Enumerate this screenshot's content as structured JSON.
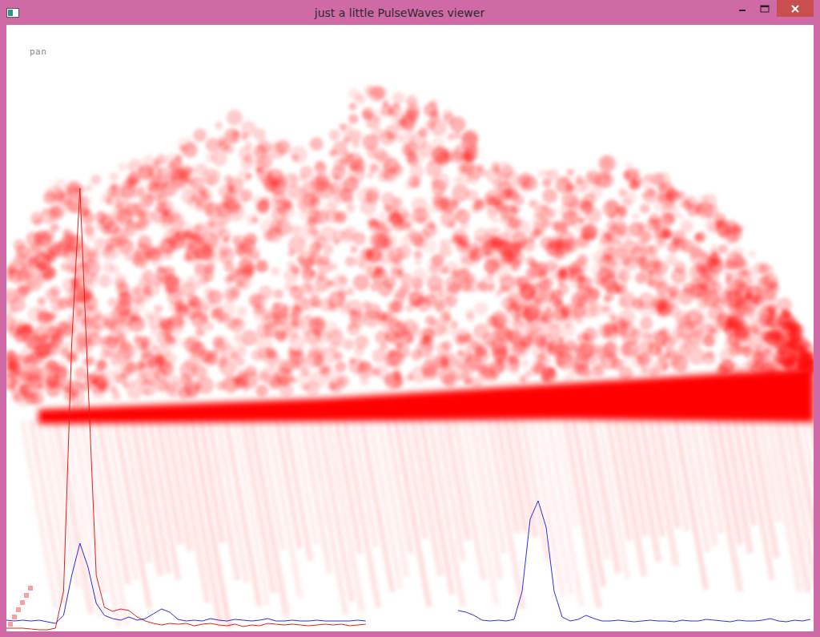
{
  "window": {
    "title": "just a little PulseWaves viewer"
  },
  "mode": {
    "label": "pan"
  },
  "waveforms": [
    {
      "series": [
        {
          "color": "#e0201a",
          "values": [
            -6,
            -6,
            -6,
            -7,
            -8,
            -8,
            -6,
            40,
            350,
            543,
            300,
            60,
            20,
            15,
            18,
            16,
            8,
            3,
            0,
            -2,
            0,
            -1,
            0,
            -3,
            -1,
            0,
            -2,
            -3,
            -1,
            -4,
            -2,
            -3,
            0,
            -1,
            -2,
            -1,
            -2,
            -3,
            -2,
            -1,
            -2,
            -1,
            -3,
            -2,
            -1
          ]
        },
        {
          "color": "#2a2ae0",
          "values": [
            4,
            3,
            4,
            3,
            4,
            2,
            0,
            10,
            60,
            100,
            70,
            25,
            10,
            6,
            4,
            8,
            4,
            6,
            12,
            18,
            14,
            5,
            3,
            4,
            3,
            6,
            4,
            3,
            5,
            4,
            3,
            4,
            6,
            3,
            3,
            4,
            3,
            3,
            4,
            3,
            3,
            3,
            3,
            4,
            3
          ]
        }
      ]
    },
    {
      "series": [
        {
          "color": "#3030e0",
          "values": [
            16,
            14,
            10,
            4,
            3,
            4,
            3,
            5,
            40,
            130,
            153,
            120,
            40,
            8,
            3,
            5,
            10,
            6,
            3,
            3,
            4,
            3,
            2,
            3,
            4,
            3,
            3,
            2,
            4,
            3,
            3,
            5,
            4,
            3,
            2,
            4,
            3,
            3,
            4,
            6,
            3,
            2,
            4,
            3,
            5
          ]
        }
      ]
    }
  ]
}
